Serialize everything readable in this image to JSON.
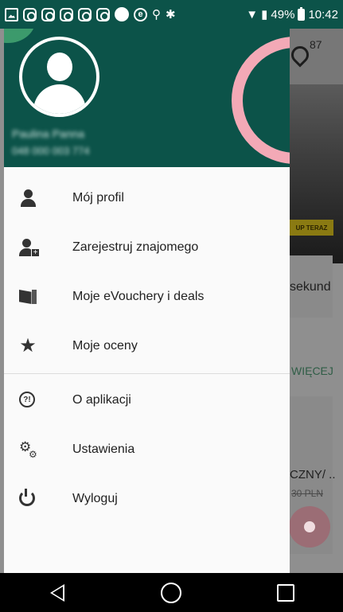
{
  "status_bar": {
    "battery_percent": "49%",
    "time": "10:42",
    "notification_icons": [
      "image-icon",
      "instagram-icon",
      "instagram-icon",
      "instagram-icon",
      "instagram-icon",
      "instagram-icon",
      "messenger-icon",
      "e-icon",
      "usb-icon",
      "debug-icon"
    ]
  },
  "background_app": {
    "location_count": "87",
    "badge_text": "UP TERAZ",
    "card_text": "sekund",
    "more_link": "WIĘCEJ",
    "product_title": "CZNY/ ..",
    "product_price": "30 PLN"
  },
  "drawer": {
    "user": {
      "name": "Paulina Panna",
      "phone": "048 000 003 774"
    },
    "menu_items": [
      {
        "label": "Mój profil",
        "icon": "person-icon"
      },
      {
        "label": "Zarejestruj znajomego",
        "icon": "add-person-icon"
      },
      {
        "label": "Moje eVouchery i deals",
        "icon": "voucher-icon"
      },
      {
        "label": "Moje oceny",
        "icon": "star-icon"
      },
      {
        "label": "O aplikacji",
        "icon": "about-icon"
      },
      {
        "label": "Ustawienia",
        "icon": "settings-icon"
      },
      {
        "label": "Wyloguj",
        "icon": "power-icon"
      }
    ]
  },
  "colors": {
    "header_green": "#0c5349",
    "accent_pink": "#f3a9b6",
    "accent_green": "#3c9a6c"
  }
}
